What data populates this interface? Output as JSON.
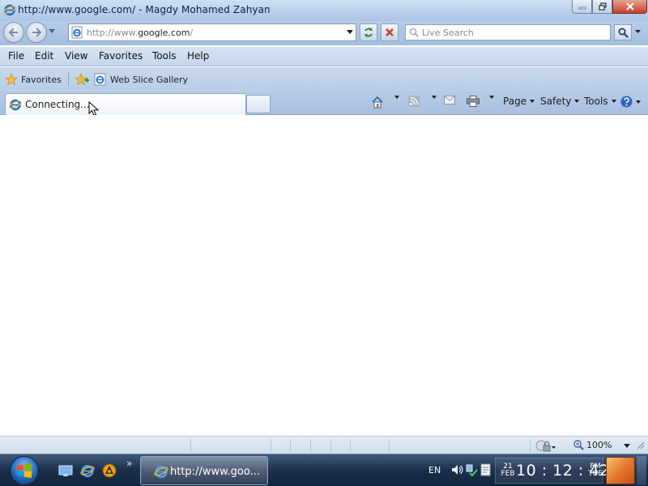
{
  "window": {
    "title": "http://www.google.com/ - Magdy Mohamed Zahyan",
    "minimize_icon": "minimize-icon",
    "maximize_icon": "restore-icon",
    "close_icon": "close-icon"
  },
  "address_bar": {
    "url_prefix": "http://www.",
    "url_domain": "google.com",
    "url_suffix": "/",
    "search_placeholder": "Live Search"
  },
  "menu": {
    "items": [
      "File",
      "Edit",
      "View",
      "Favorites",
      "Tools",
      "Help"
    ]
  },
  "favorites_bar": {
    "favorites_label": "Favorites",
    "web_slice_label": "Web Slice Gallery"
  },
  "tab": {
    "label": "Connecting..."
  },
  "command_bar": {
    "page_label": "Page",
    "safety_label": "Safety",
    "tools_label": "Tools"
  },
  "status_bar": {
    "zoom": "100%"
  },
  "taskbar": {
    "task_label": "http://www.goo...",
    "language": "EN",
    "date_day": "21",
    "date_month": "FEB",
    "time": "10 : 12 : 42",
    "ampm": "PM",
    "weekday": "TUE"
  },
  "colors": {
    "chrome_blue": "#b6cce8",
    "taskbar": "#1c2f4a",
    "ie_blue": "#1f6fd0",
    "ie_gold": "#f2b632"
  }
}
